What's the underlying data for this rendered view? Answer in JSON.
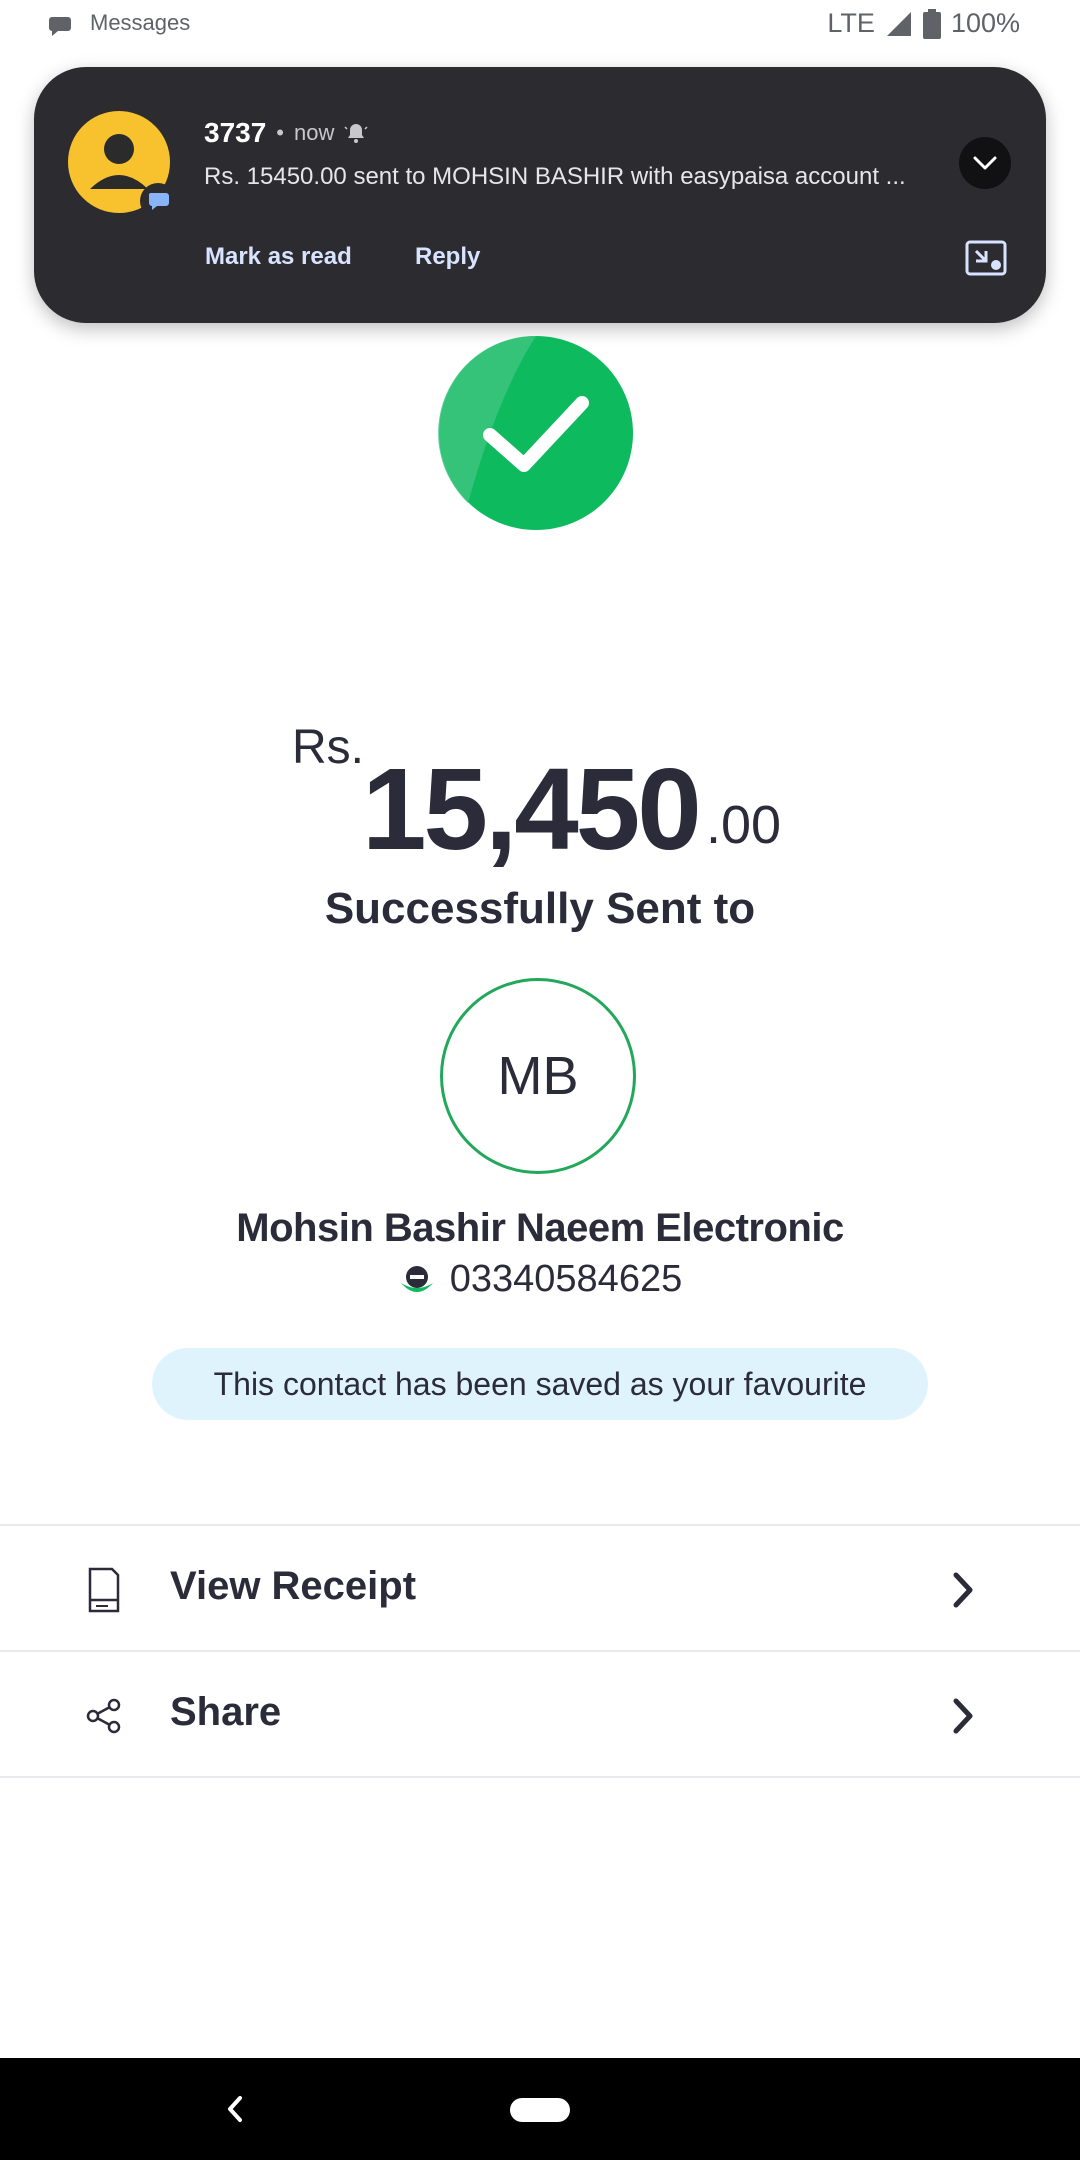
{
  "status_bar": {
    "app_name": "Messages",
    "network": "LTE",
    "battery": "100%"
  },
  "notification": {
    "sender": "3737",
    "dot": "•",
    "time": "now",
    "body": "Rs. 15450.00 sent to MOHSIN BASHIR with easypaisa account ...",
    "actions": [
      "Mark as read",
      "Reply"
    ]
  },
  "payment": {
    "currency": "Rs.",
    "amount_main": "15,450",
    "amount_decimal": ".00",
    "status_text": "Successfully Sent to"
  },
  "recipient": {
    "initials": "MB",
    "name": "Mohsin Bashir Naeem Electronic",
    "number": "03340584625"
  },
  "favourite_notice": "This contact has been saved as your favourite",
  "options": [
    {
      "label": "View Receipt",
      "icon": "receipt-icon"
    },
    {
      "label": "Share",
      "icon": "share-icon"
    }
  ],
  "colors": {
    "success_green": "#0dba5e",
    "notification_bg": "#2c2c30",
    "avatar_yellow": "#f7c22e",
    "favourite_bg": "#def3fb"
  }
}
